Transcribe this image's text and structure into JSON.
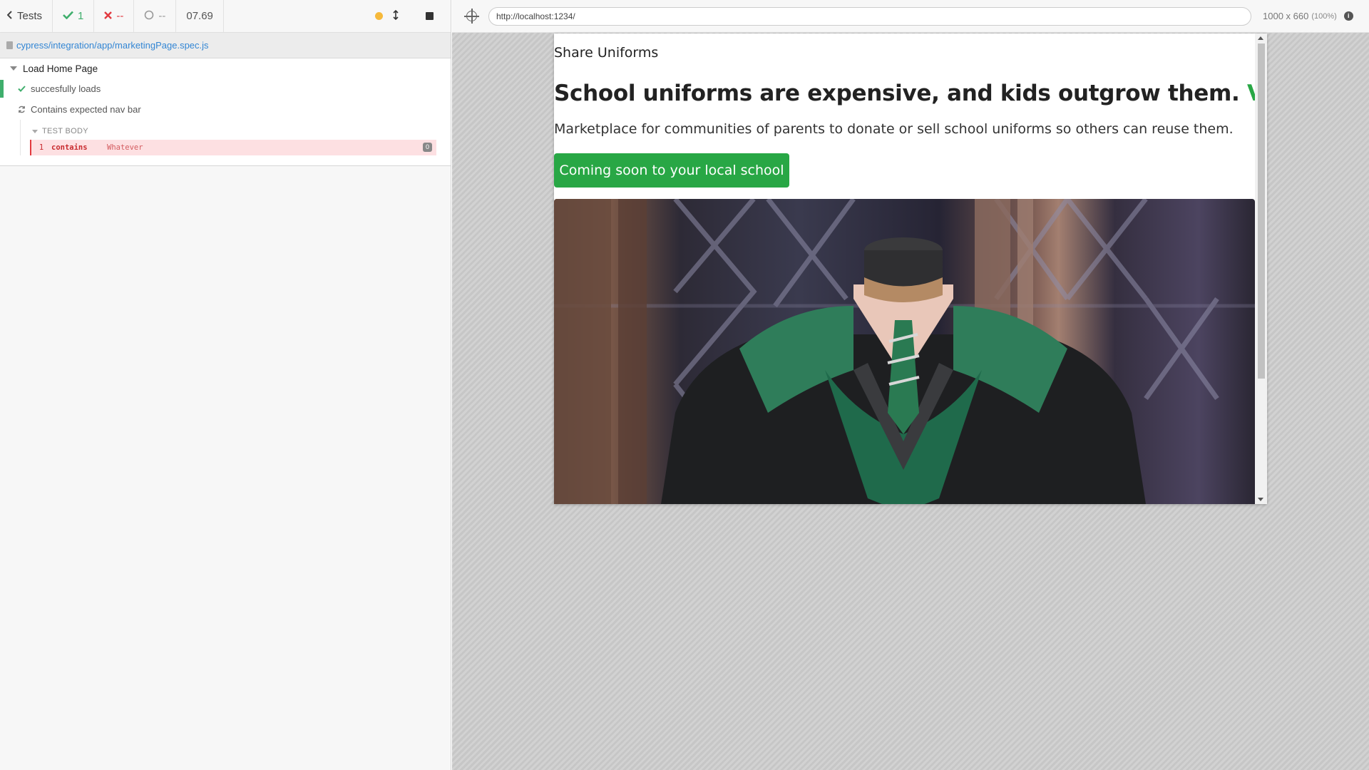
{
  "reporter": {
    "back_label": "Tests",
    "passed_count": "1",
    "failed_count": "--",
    "pending_count": "--",
    "duration": "07.69",
    "spec_path": "cypress/integration/app/marketingPage.spec.js",
    "suite_title": "Load Home Page",
    "tests": [
      {
        "title": "succesfully loads",
        "state": "passed"
      },
      {
        "title": "Contains expected nav bar",
        "state": "running"
      }
    ],
    "test_body_label": "TEST BODY",
    "command": {
      "number": "1",
      "name": "contains",
      "message": "Whatever",
      "badge": "0"
    },
    "colors": {
      "passed": "#3fae6c",
      "failed": "#e2393f",
      "link": "#3386d4"
    }
  },
  "aut": {
    "url": "http://localhost:1234/",
    "viewport_size": "1000 x 660",
    "viewport_scale": "(100%)"
  },
  "site": {
    "brand": "Share Uniforms",
    "headline": "School uniforms are expensive, and kids outgrow them.",
    "headline_accent": "Very fast.",
    "lead": "Marketplace for communities of parents to donate or sell school uniforms so others can reuse them.",
    "cta_label": "Coming soon to your local school",
    "hero_image": "school uniform on headless mannequin",
    "accent_color": "#28a745"
  }
}
